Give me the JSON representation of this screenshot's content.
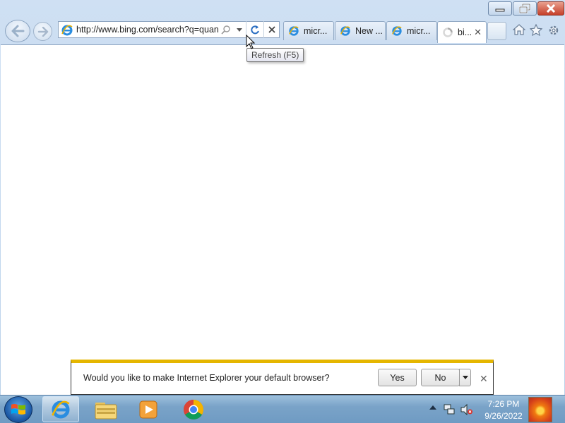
{
  "window": {
    "minimize_icon": "minimize-icon",
    "maximize_icon": "restore-icon",
    "close_icon": "close-icon"
  },
  "nav": {
    "back_icon": "back-arrow-icon",
    "forward_icon": "forward-arrow-icon",
    "address": "http://www.bing.com/search?q=quan",
    "refresh_tooltip": "Refresh (F5)"
  },
  "tabs": [
    {
      "label": "micr...",
      "active": false
    },
    {
      "label": "New ...",
      "active": false
    },
    {
      "label": "micr...",
      "active": false
    },
    {
      "label": "bi...",
      "active": true,
      "loading": true
    }
  ],
  "notification": {
    "message": "Would you like to make Internet Explorer your default browser?",
    "yes_label": "Yes",
    "no_label": "No"
  },
  "taskbar": {
    "apps": [
      "internet-explorer",
      "windows-explorer",
      "windows-media-player",
      "google-chrome"
    ],
    "time": "7:26 PM",
    "date": "9/26/2022"
  },
  "colors": {
    "notification_accent": "#e5b600",
    "close_button": "#c5402a",
    "taskbar": "#7aa3c8"
  }
}
